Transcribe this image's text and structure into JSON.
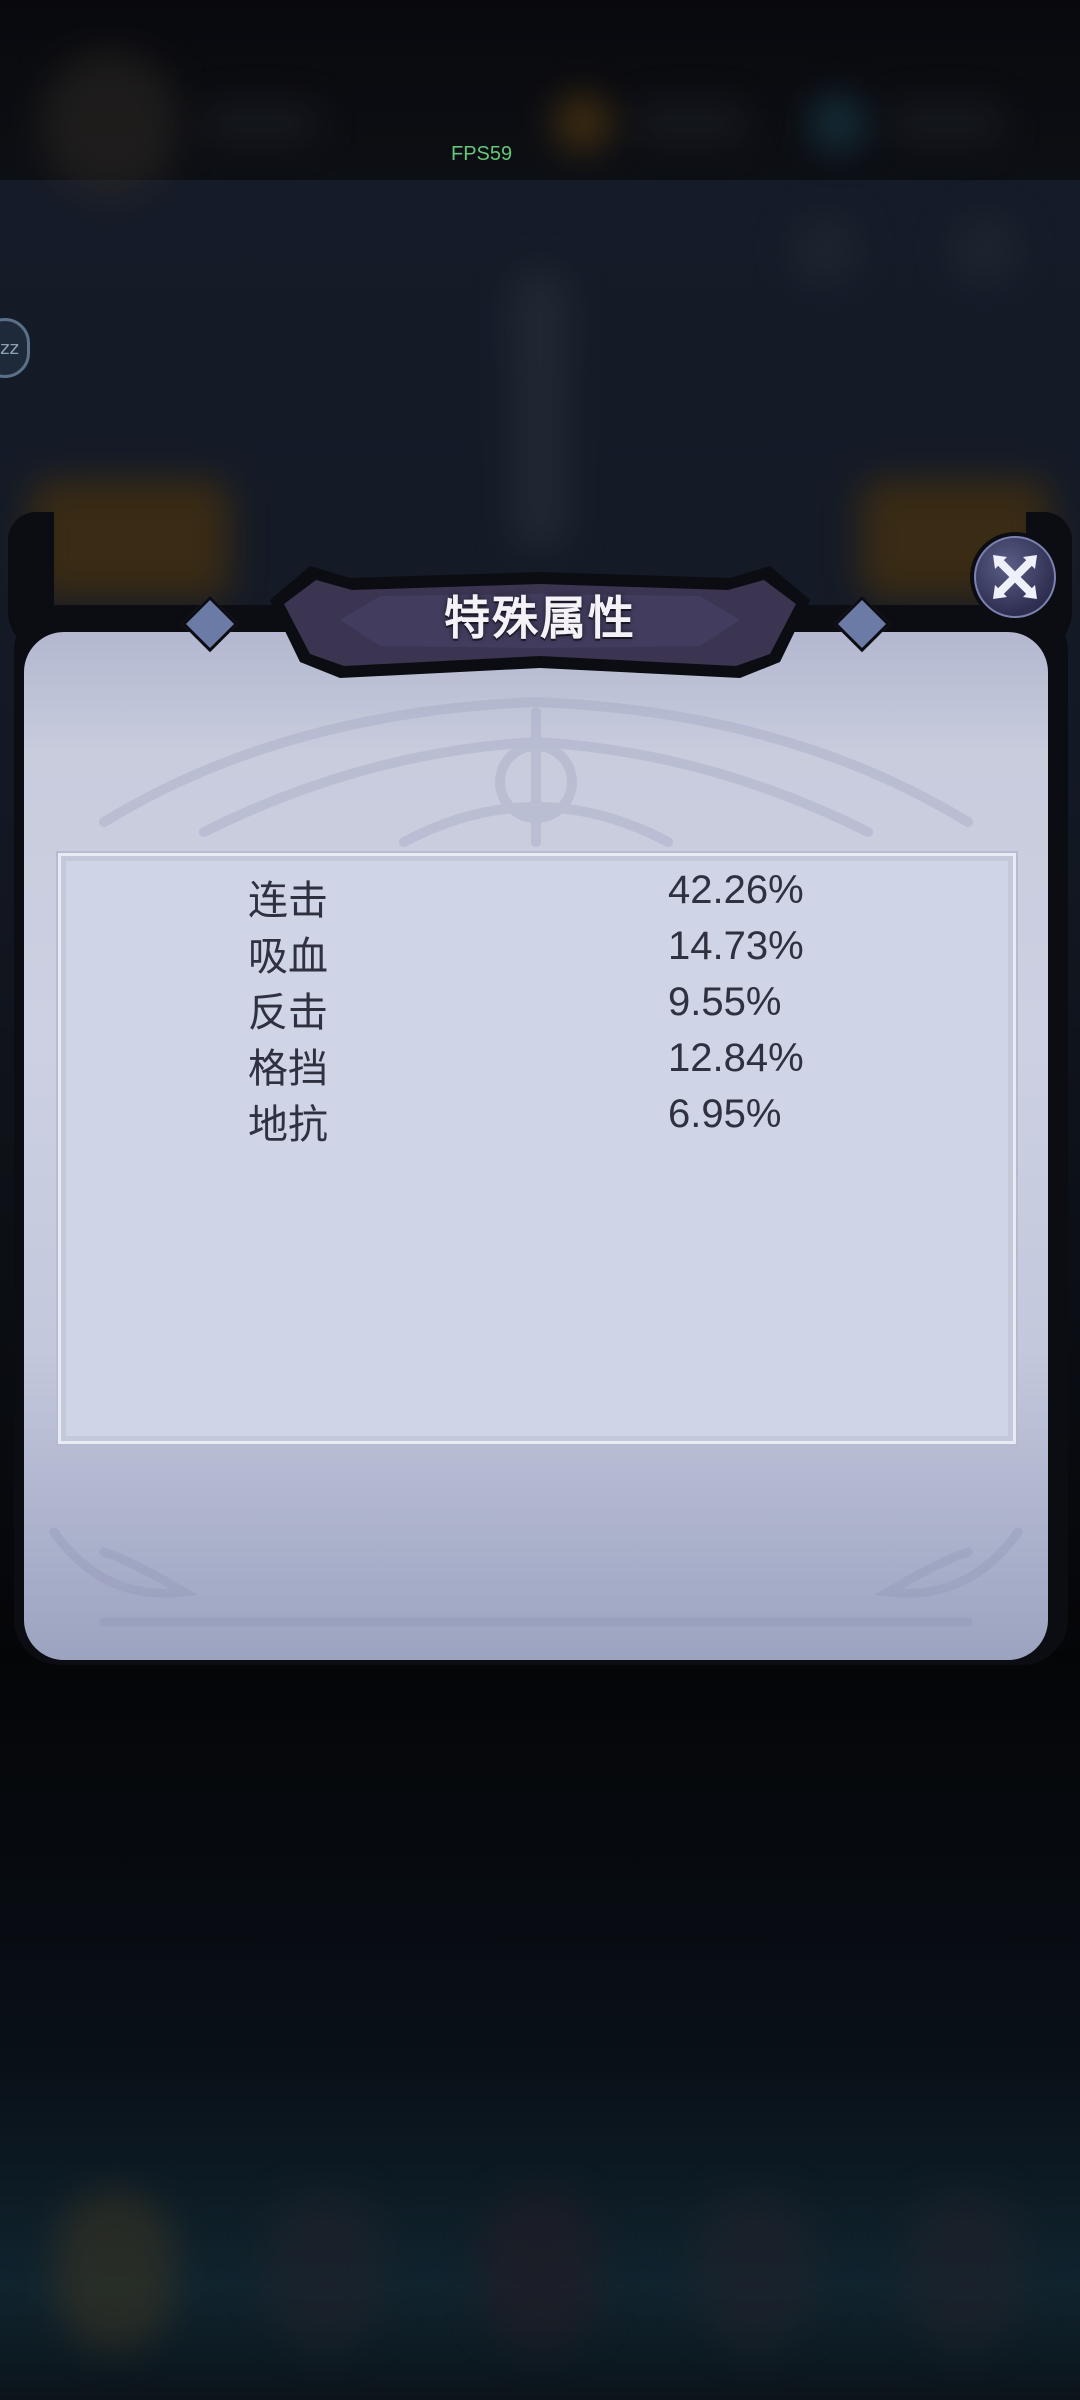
{
  "status": {
    "fps": "FPS59"
  },
  "side_bubble": {
    "label": "zz"
  },
  "dialog": {
    "title": "特殊属性",
    "stats": [
      {
        "name": "连击",
        "value": "42.26%"
      },
      {
        "name": "吸血",
        "value": "14.73%"
      },
      {
        "name": "反击",
        "value": "9.55%"
      },
      {
        "name": "格挡",
        "value": "12.84%"
      },
      {
        "name": "地抗",
        "value": "6.95%"
      }
    ]
  },
  "icons": {
    "close": "close-x-icon"
  },
  "colors": {
    "panel": "#ccd0e2",
    "banner": "#3b3552",
    "frame": "#0c0d12",
    "text": "#2f3040",
    "fps": "#65c777"
  }
}
